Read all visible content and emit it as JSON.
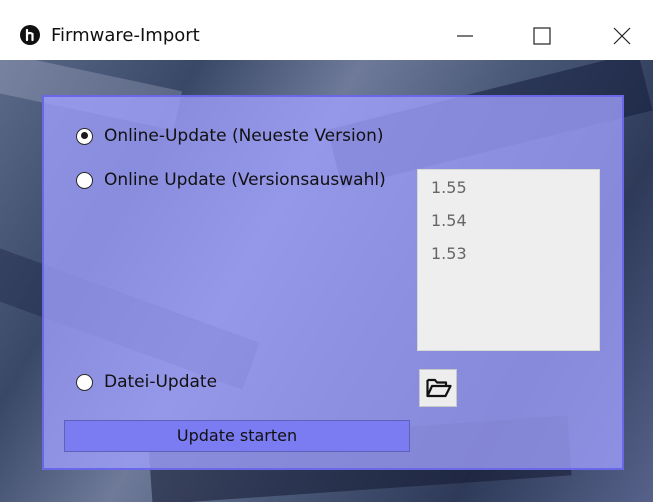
{
  "window": {
    "title": "Firmware-Import"
  },
  "options": {
    "online_latest": "Online-Update (Neueste Version)",
    "online_select": "Online Update (Versionsauswahl)",
    "file_update": "Datei-Update",
    "selected": "online_latest"
  },
  "versions": [
    "1.55",
    "1.54",
    "1.53"
  ],
  "buttons": {
    "start": "Update starten"
  },
  "icons": {
    "app": "app-logo-icon",
    "minimize": "minimize-icon",
    "maximize": "maximize-icon",
    "close": "close-icon",
    "folder": "folder-open-icon"
  },
  "colors": {
    "panel": "#a0a0ff",
    "panel_border": "#6a68e8",
    "start_button": "#7b7bf2"
  }
}
